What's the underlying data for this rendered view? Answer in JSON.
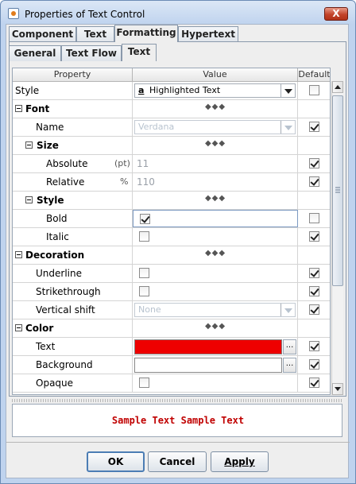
{
  "window": {
    "title": "Properties of Text Control",
    "close": "X"
  },
  "top_tabs": [
    "Component",
    "Text",
    "Formatting",
    "Hypertext"
  ],
  "sub_tabs": [
    "General",
    "Text Flow",
    "Text"
  ],
  "table": {
    "headers": {
      "property": "Property",
      "value": "Value",
      "default": "Default"
    },
    "rows": [
      {
        "label": "Style",
        "value": "Highlighted Text",
        "value_icon": "a",
        "default": false
      },
      {
        "label": "Font",
        "group": true
      },
      {
        "label": "Name",
        "value": "Verdana",
        "default": true
      },
      {
        "label": "Size",
        "group": true
      },
      {
        "label": "Absolute",
        "unit": "(pt)",
        "value": "11",
        "default": true
      },
      {
        "label": "Relative",
        "unit": "%",
        "value": "110",
        "default": true
      },
      {
        "label": "Style",
        "group": true
      },
      {
        "label": "Bold",
        "checked": true,
        "default": false
      },
      {
        "label": "Italic",
        "checked": false,
        "default": true
      },
      {
        "label": "Decoration",
        "group": true
      },
      {
        "label": "Underline",
        "checked": false,
        "default": true
      },
      {
        "label": "Strikethrough",
        "checked": false,
        "default": true
      },
      {
        "label": "Vertical shift",
        "value": "None",
        "default": true
      },
      {
        "label": "Color",
        "group": true
      },
      {
        "label": "Text",
        "color": "#ee0000",
        "default": true
      },
      {
        "label": "Background",
        "color": "#ffffff",
        "default": true
      },
      {
        "label": "Opaque",
        "checked": false,
        "default": true
      }
    ]
  },
  "preview": {
    "text": "Sample Text Sample Text",
    "color": "#c00000"
  },
  "buttons": {
    "ok": "OK",
    "cancel": "Cancel",
    "apply": "Apply"
  },
  "ellipsis": "..."
}
